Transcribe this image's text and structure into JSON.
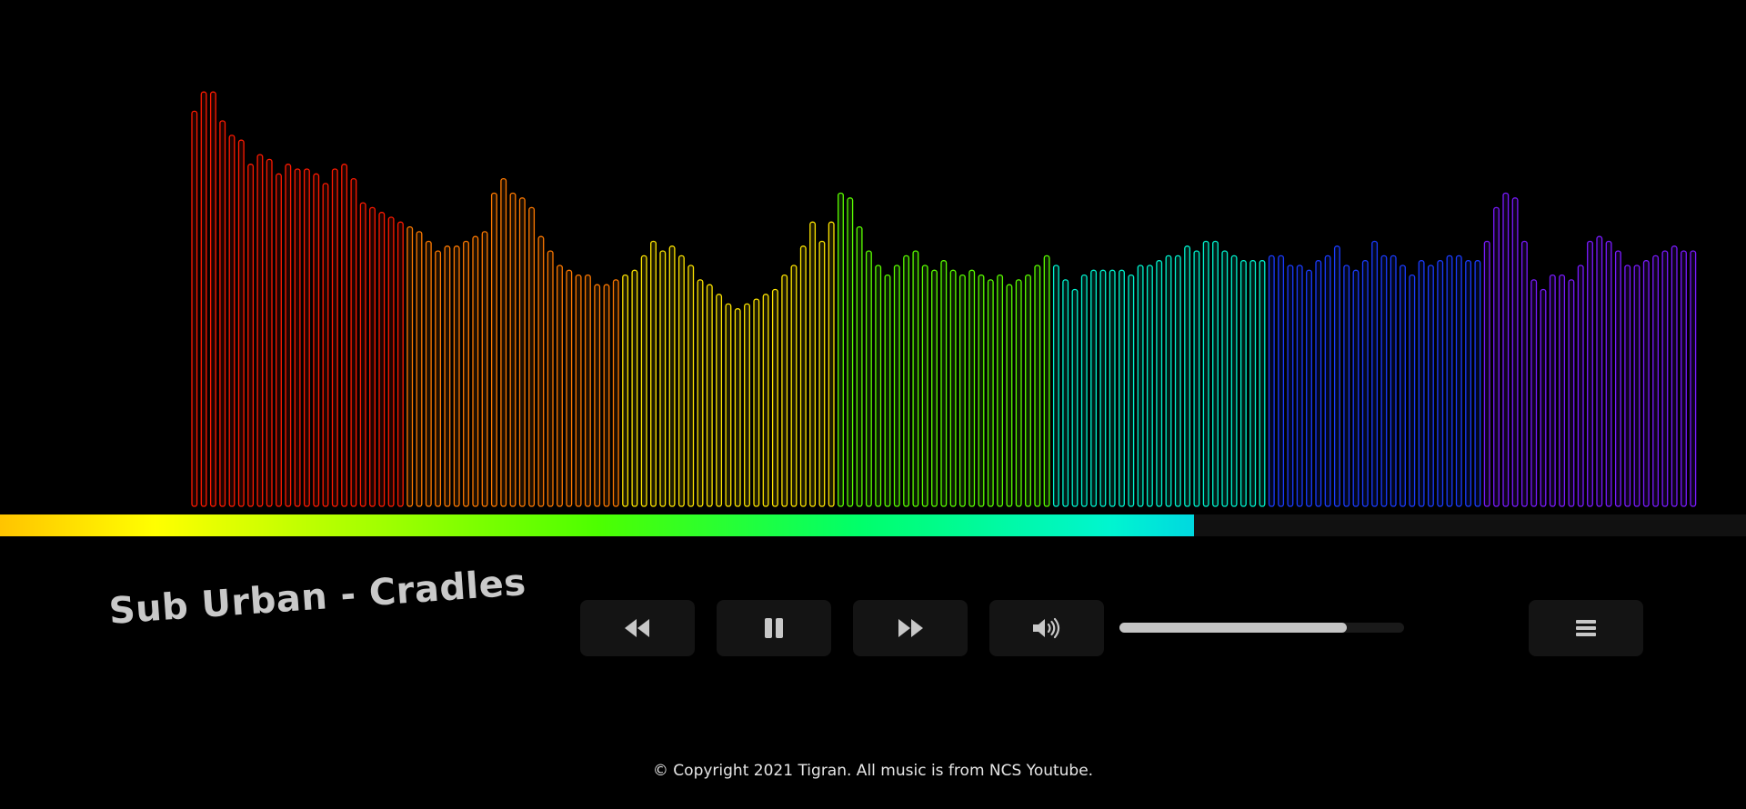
{
  "player": {
    "song_title": "Sub Urban - Cradles",
    "progress": 0.684,
    "volume": 0.8
  },
  "controls": {
    "rewind_icon": "rewind-icon",
    "pause_icon": "pause-icon",
    "fast_forward_icon": "fast-forward-icon",
    "volume_icon": "volume-icon",
    "menu_icon": "menu-icon"
  },
  "footer": {
    "copyright": "© Copyright 2021 Tigran. All music is from NCS Youtube."
  },
  "visualizer": {
    "baseline_color": "#000000",
    "color_groups": [
      {
        "color": "#ff1a00",
        "levels": [
          0.82,
          0.86,
          0.86,
          0.8,
          0.77,
          0.76,
          0.71,
          0.73,
          0.72,
          0.69,
          0.71,
          0.7,
          0.7,
          0.69,
          0.67,
          0.7,
          0.71,
          0.68,
          0.63,
          0.62,
          0.61,
          0.6,
          0.59
        ]
      },
      {
        "color": "#ff7a00",
        "levels": [
          0.58,
          0.57,
          0.55,
          0.53,
          0.54,
          0.54,
          0.55,
          0.56,
          0.57,
          0.65,
          0.68,
          0.65,
          0.64,
          0.62,
          0.56,
          0.53,
          0.5,
          0.49,
          0.48,
          0.48,
          0.46,
          0.46,
          0.47
        ]
      },
      {
        "color": "#ffe600",
        "levels": [
          0.48,
          0.49,
          0.52,
          0.55,
          0.53,
          0.54,
          0.52,
          0.5,
          0.47,
          0.46,
          0.44,
          0.42,
          0.41,
          0.42,
          0.43,
          0.44,
          0.45,
          0.48,
          0.5,
          0.54,
          0.59,
          0.55,
          0.59
        ]
      },
      {
        "color": "#5aff00",
        "levels": [
          0.65,
          0.64,
          0.58,
          0.53,
          0.5,
          0.48,
          0.5,
          0.52,
          0.53,
          0.5,
          0.49,
          0.51,
          0.49,
          0.48,
          0.49,
          0.48,
          0.47,
          0.48,
          0.46,
          0.47,
          0.48,
          0.5,
          0.52
        ]
      },
      {
        "color": "#00f5d0",
        "levels": [
          0.5,
          0.47,
          0.45,
          0.48,
          0.49,
          0.49,
          0.49,
          0.49,
          0.48,
          0.5,
          0.5,
          0.51,
          0.52,
          0.52,
          0.54,
          0.53,
          0.55,
          0.55,
          0.53,
          0.52,
          0.51,
          0.51,
          0.51
        ]
      },
      {
        "color": "#1a3cff",
        "levels": [
          0.52,
          0.52,
          0.5,
          0.5,
          0.49,
          0.51,
          0.52,
          0.54,
          0.5,
          0.49,
          0.51,
          0.55,
          0.52,
          0.52,
          0.5,
          0.48,
          0.51,
          0.5,
          0.51,
          0.52,
          0.52,
          0.51,
          0.51
        ]
      },
      {
        "color": "#7a1aff",
        "levels": [
          0.55,
          0.62,
          0.65,
          0.64,
          0.55,
          0.47,
          0.45,
          0.48,
          0.48,
          0.47,
          0.5,
          0.55,
          0.56,
          0.55,
          0.53,
          0.5,
          0.5,
          0.51,
          0.52,
          0.53,
          0.54,
          0.53,
          0.53
        ]
      }
    ]
  }
}
